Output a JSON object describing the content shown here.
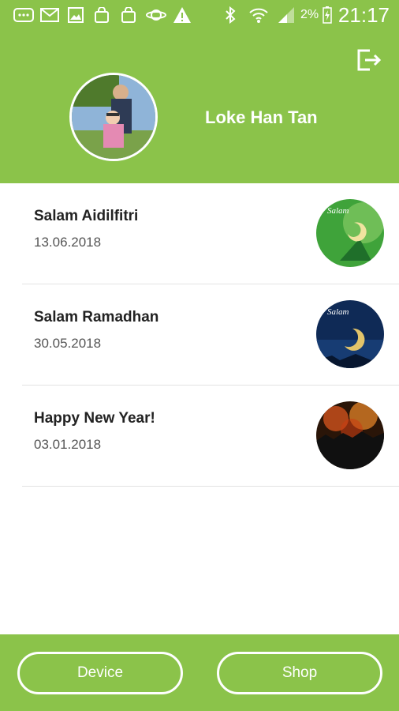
{
  "status_bar": {
    "battery_percent": "2%",
    "time": "21:17"
  },
  "profile": {
    "name": "Loke Han Tan"
  },
  "cards": [
    {
      "title": "Salam Aidilfitri",
      "date": "13.06.2018",
      "thumb": "eid-greeting-image"
    },
    {
      "title": "Salam Ramadhan",
      "date": "30.05.2018",
      "thumb": "ramadan-greeting-image"
    },
    {
      "title": "Happy New Year!",
      "date": "03.01.2018",
      "thumb": "fireworks-image"
    }
  ],
  "bottom_nav": {
    "device_label": "Device",
    "shop_label": "Shop"
  },
  "colors": {
    "brand_green": "#8bc34a",
    "text_dark": "#222222",
    "text_muted": "#555555"
  }
}
